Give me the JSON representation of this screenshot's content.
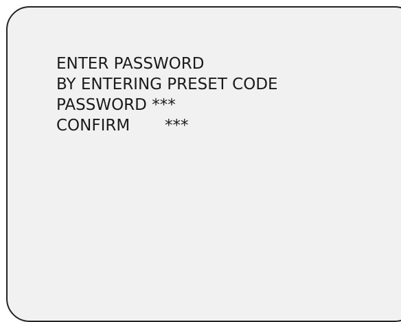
{
  "osd": {
    "line1": "ENTER PASSWORD",
    "line2": "BY ENTERING PRESET CODE",
    "password_label": "PASSWORD",
    "password_value": "***",
    "confirm_label": "CONFIRM",
    "confirm_value": "***"
  }
}
